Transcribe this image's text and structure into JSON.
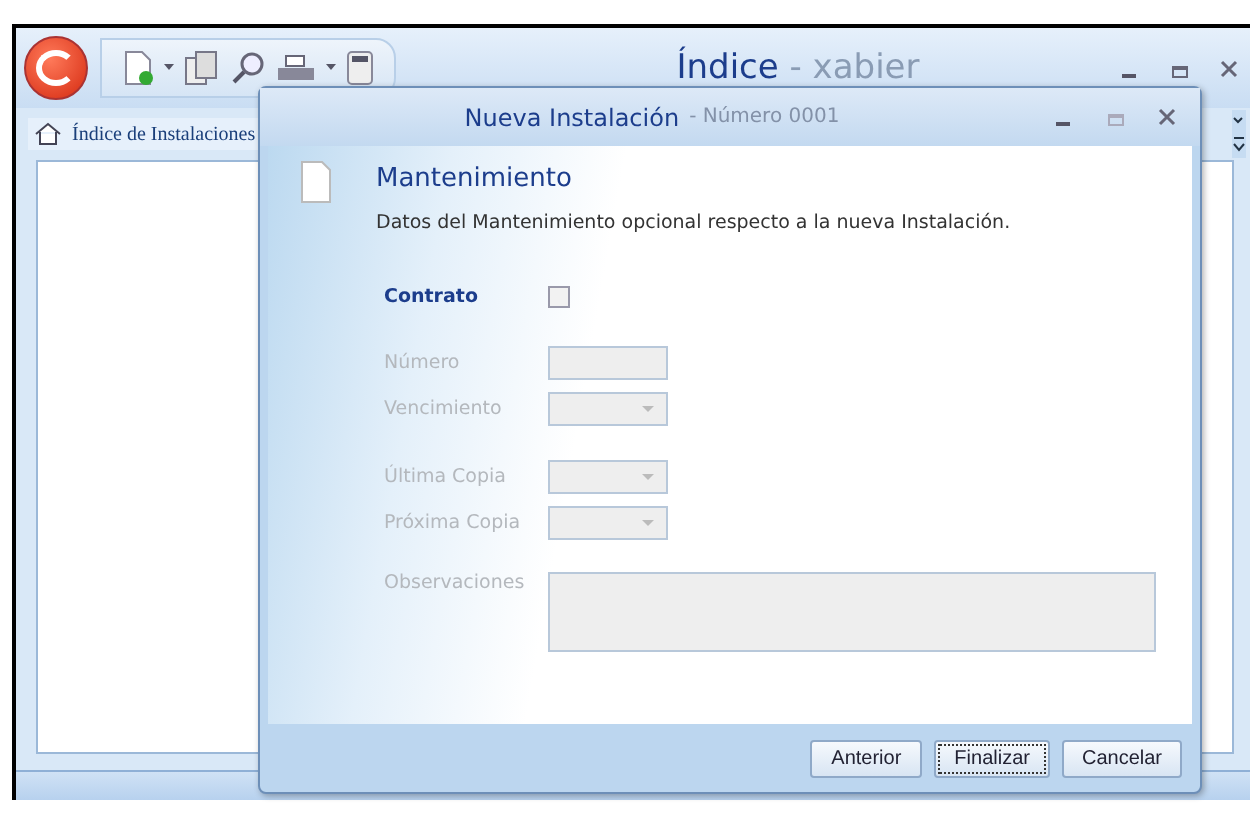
{
  "window": {
    "title": "Índice",
    "user": "- xabier"
  },
  "tabs": [
    {
      "label": "Índice de Instalaciones",
      "selected": true
    }
  ],
  "dialog": {
    "title": "Nueva Instalación",
    "subtitle": "- Número 0001",
    "heading": "Mantenimiento",
    "description": "Datos del Mantenimiento opcional respecto a la nueva Instalación.",
    "fields": [
      {
        "kind": "checkbox",
        "label": "Contrato",
        "disabled": false,
        "checked": false
      },
      {
        "kind": "text",
        "label": "Número",
        "disabled": true
      },
      {
        "kind": "select",
        "label": "Vencimiento",
        "disabled": true
      },
      {
        "kind": "select",
        "label": "Última Copia",
        "disabled": true,
        "gap": true
      },
      {
        "kind": "select",
        "label": "Próxima Copia",
        "disabled": true
      },
      {
        "kind": "textarea",
        "label": "Observaciones",
        "disabled": true,
        "gap": true
      }
    ],
    "buttons": [
      {
        "label": "Anterior",
        "focused": false
      },
      {
        "label": "Finalizar",
        "focused": true
      },
      {
        "label": "Cancelar",
        "focused": false
      }
    ]
  }
}
